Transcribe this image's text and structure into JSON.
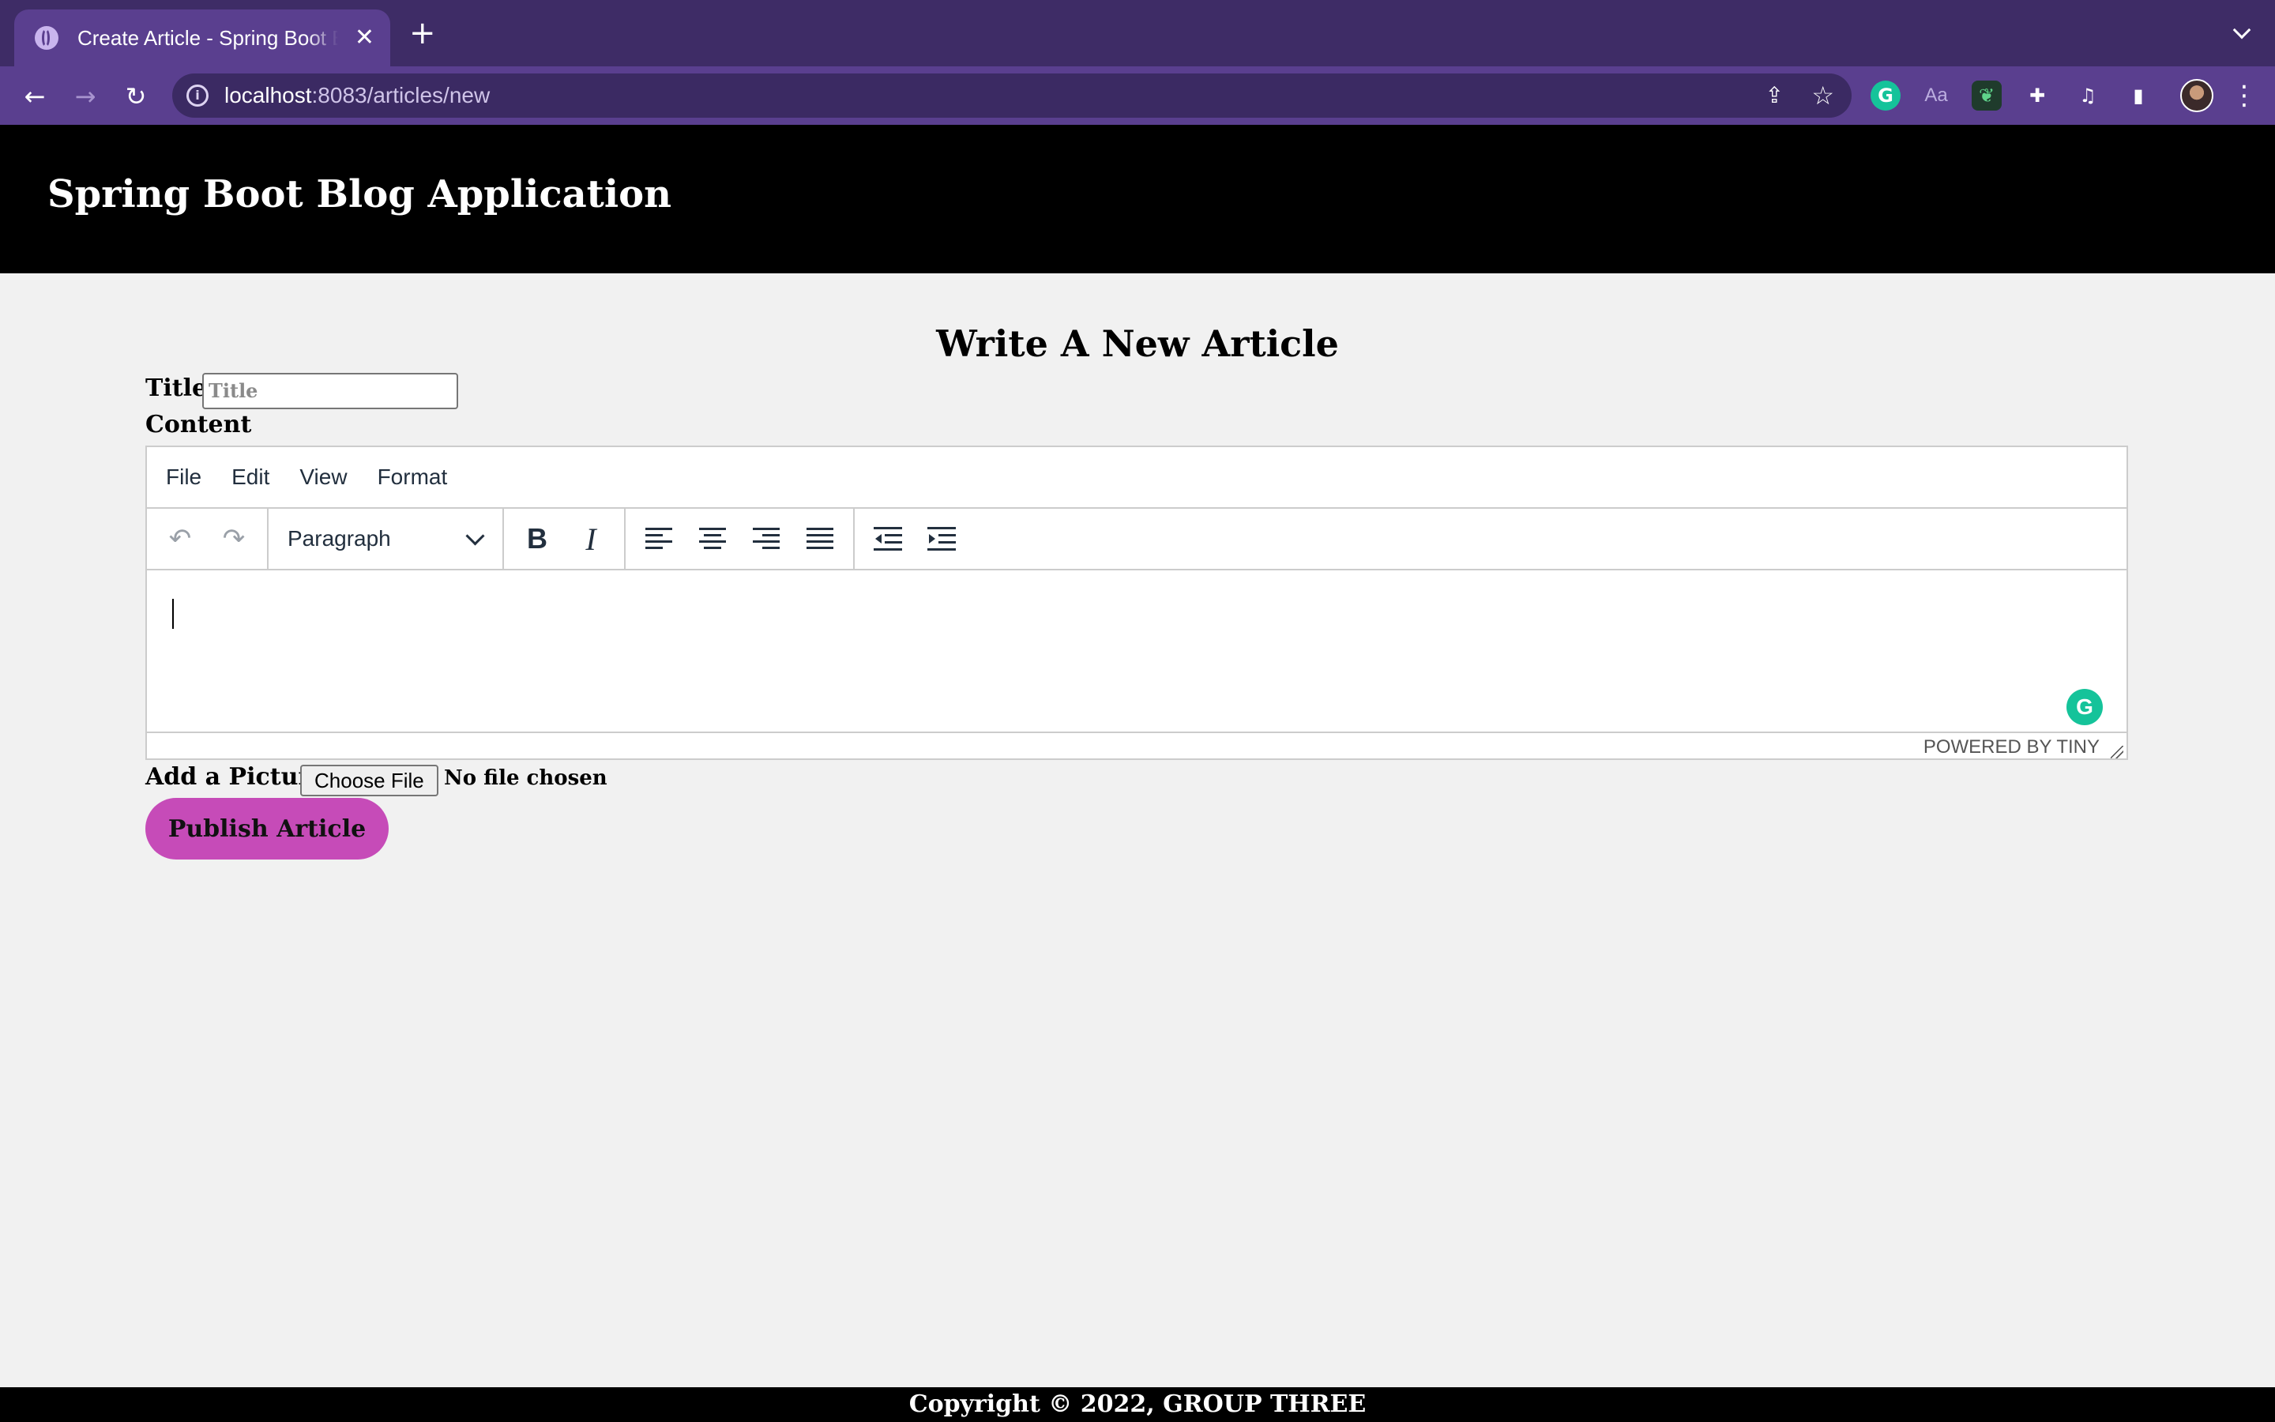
{
  "browser": {
    "tab_title": "Create Article - Spring Boot Blog Application",
    "tab_close": "✕",
    "new_tab": "+",
    "url_host": "localhost",
    "url_path": ":8083/articles/new",
    "icons": [
      "back-icon",
      "forward-icon",
      "reload-icon",
      "info-icon",
      "share-icon",
      "star-icon",
      "grammarly-icon",
      "reader-icon",
      "leaf-icon",
      "extensions-icon",
      "media-icon",
      "side-panel-icon",
      "menu-icon"
    ]
  },
  "header": {
    "site_title": "Spring Boot Blog Application"
  },
  "form": {
    "heading": "Write A New Article",
    "title_label": "Title",
    "title_placeholder": "Title",
    "title_value": "",
    "content_label": "Content",
    "picture_label": "Add a Picture",
    "choose_file_label": "Choose File",
    "file_status": "No file chosen",
    "publish_label": "Publish Article"
  },
  "editor": {
    "menus": [
      "File",
      "Edit",
      "View",
      "Format"
    ],
    "block_format": "Paragraph",
    "bold_glyph": "B",
    "italic_glyph": "I",
    "powered_by": "POWERED BY TINY",
    "grammarly_glyph": "G"
  },
  "footer": {
    "text": "Copyright © 2022, GROUP THREE"
  },
  "colors": {
    "tab_strip": "#3e2c66",
    "toolbar": "#5a3f8f",
    "header_bg": "#000000",
    "page_bg": "#f1f1f1",
    "publish_button": "#c64bb8",
    "grammarly": "#15c39a"
  }
}
